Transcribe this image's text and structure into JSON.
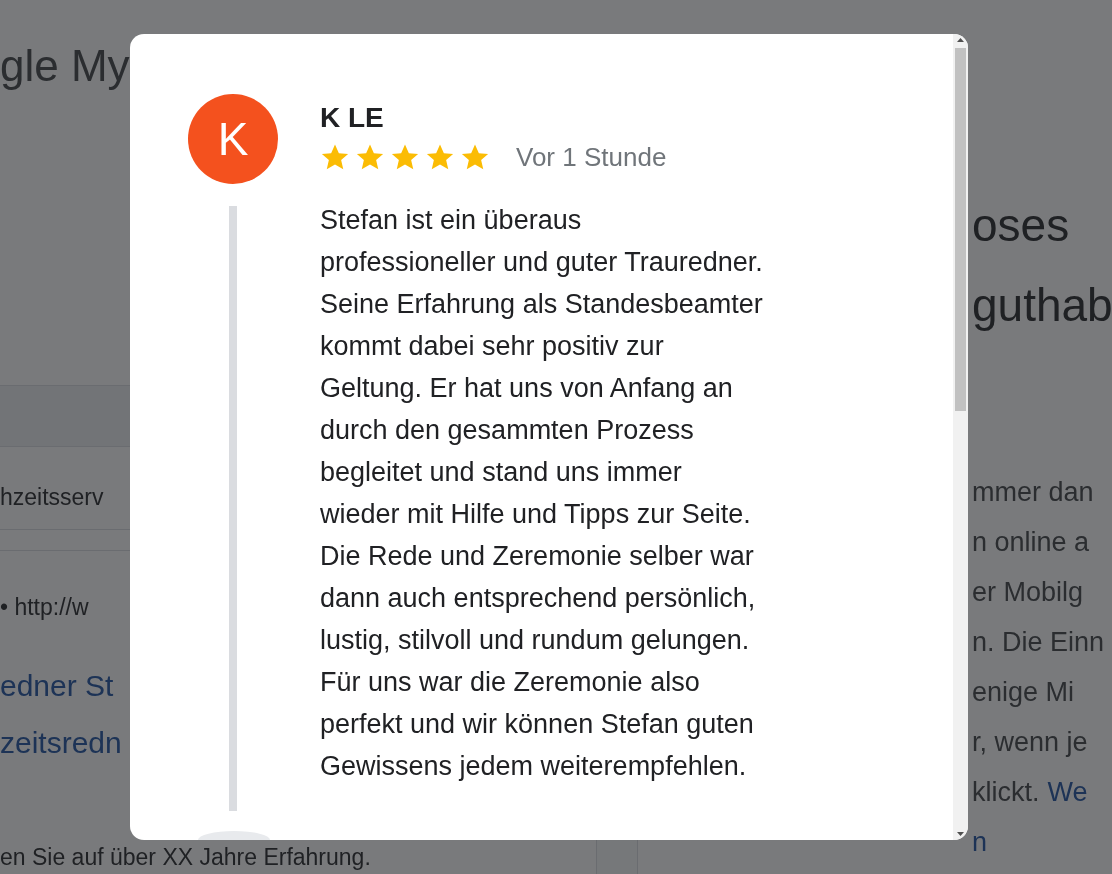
{
  "background": {
    "logo": "gle My",
    "left": [
      {
        "kind": "label",
        "text": "hzeitsserv"
      },
      {
        "kind": "url",
        "text": "• http://w"
      },
      {
        "kind": "title",
        "text": "edner St"
      },
      {
        "kind": "title",
        "text": "zeitsredn"
      },
      {
        "kind": "body",
        "text": "en Sie auf über XX Jahre Erfahrung."
      }
    ],
    "right": {
      "heading": [
        "oses",
        "guthab"
      ],
      "paragraph": [
        {
          "text": "mmer dan"
        },
        {
          "text": "n online a"
        },
        {
          "text": "er Mobilg"
        },
        {
          "text": "n. Die Einn"
        },
        {
          "text": "enige Mi"
        },
        {
          "text": "r, wenn je"
        },
        {
          "text": "klickt.",
          "link": "We"
        },
        {
          "link": "n"
        }
      ]
    }
  },
  "review": {
    "avatar_letter": "K",
    "author": "K LE",
    "stars": 5,
    "time": "Vor 1 Stunde",
    "text": "Stefan ist ein überaus\nprofessioneller und guter Trauredner.\nSeine Erfahrung als Standesbeamter\nkommt dabei sehr positiv zur\nGeltung. Er hat uns von Anfang an\ndurch den gesammten Prozess\nbegleitet und stand uns immer\nwieder mit Hilfe und Tipps zur Seite.\nDie Rede und Zeremonie selber war\ndann auch entsprechend persönlich,\nlustig, stilvoll und rundum gelungen.\nFür uns war die Zeremonie also\nperfekt und wir können Stefan guten\nGewissens jedem weiterempfehlen."
  }
}
